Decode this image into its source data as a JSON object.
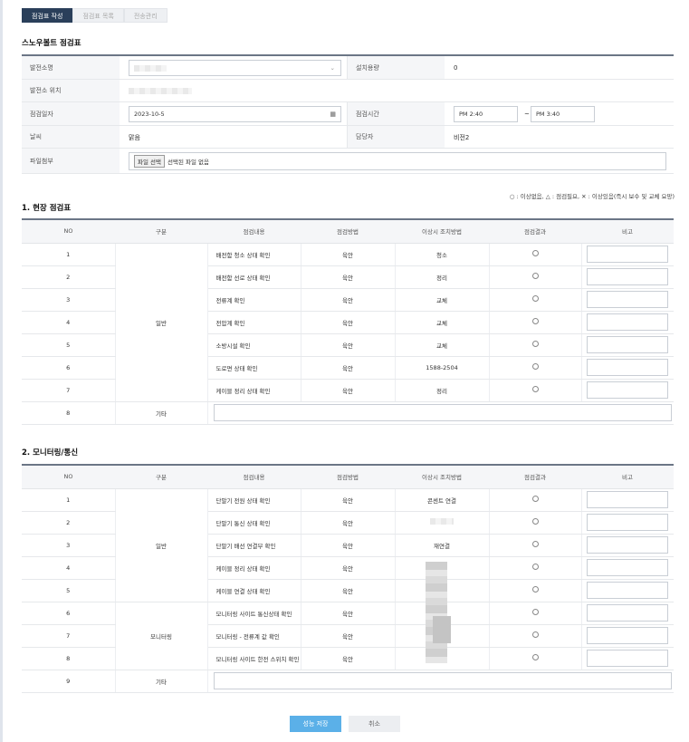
{
  "tabs": [
    {
      "label": "점검표 작성",
      "active": true
    },
    {
      "label": "점검표 목록",
      "active": false
    },
    {
      "label": "전송관리",
      "active": false
    }
  ],
  "form": {
    "title": "스노우볼트 점검표",
    "plant_name_label": "발전소명",
    "capacity_label": "설치용량",
    "capacity_value": "0",
    "location_label": "발전소 위치",
    "date_label": "점검일자",
    "date_value": "2023-10-5",
    "time_label": "점검시간",
    "time_start": "PM 2:40",
    "time_sep": "~",
    "time_end": "PM 3:40",
    "weather_label": "날씨",
    "weather_value": "맑음",
    "manager_label": "담당자",
    "manager_value": "비전2",
    "file_label": "파일첨부",
    "file_button": "파일 선택",
    "file_status": "선택된 파일 없음"
  },
  "legend": "○ : 이상없음, △ : 점검필요, ✕ : 이상있음(즉시 보수 및 교체 요망)",
  "section1": {
    "title": "1. 현장 점검표",
    "headers": [
      "NO",
      "구분",
      "점검내용",
      "점검방법",
      "이상시 조치방법",
      "점검결과",
      "비고"
    ],
    "group": "일반",
    "rows": [
      {
        "no": "1",
        "content": "배전함 청소 상태 확인",
        "method": "육안",
        "action": "청소"
      },
      {
        "no": "2",
        "content": "배전함 선로 상태 확인",
        "method": "육안",
        "action": "정리"
      },
      {
        "no": "3",
        "content": "전류계 확인",
        "method": "육안",
        "action": "교체"
      },
      {
        "no": "4",
        "content": "전압계 확인",
        "method": "육안",
        "action": "교체"
      },
      {
        "no": "5",
        "content": "소방시설 확인",
        "method": "육안",
        "action": "교체"
      },
      {
        "no": "6",
        "content": "도로면 상태 확인",
        "method": "육안",
        "action": "1588-2504"
      },
      {
        "no": "7",
        "content": "케이블 정리 상태 확인",
        "method": "육안",
        "action": "정리"
      }
    ],
    "etc": {
      "no": "8",
      "label": "기타"
    }
  },
  "section2": {
    "title": "2. 모니터링/통신",
    "headers": [
      "NO",
      "구분",
      "점검내용",
      "점검방법",
      "이상시 조치방법",
      "점검결과",
      "비고"
    ],
    "group1": "일반",
    "group2": "모니터링",
    "rows": [
      {
        "no": "1",
        "content": "단말기 전원 상태 확인",
        "method": "육안",
        "action": "콘센트 연결"
      },
      {
        "no": "2",
        "content": "단말기 통신 상태 확인",
        "method": "육안",
        "action": ""
      },
      {
        "no": "3",
        "content": "단말기 배선 연결부 확인",
        "method": "육안",
        "action": "재연결"
      },
      {
        "no": "4",
        "content": "케이블 정리 상태 확인",
        "method": "육안",
        "action": ""
      },
      {
        "no": "5",
        "content": "케이블 연결 상태 확인",
        "method": "육안",
        "action": ""
      },
      {
        "no": "6",
        "content": "모니터링 사이트 통신상태 확인",
        "method": "육안",
        "action": ""
      },
      {
        "no": "7",
        "content": "모니터링 - 전류계 값 확인",
        "method": "육안",
        "action": ""
      },
      {
        "no": "8",
        "content": "모니터링 사이트 한전 스위치 확인",
        "method": "육안",
        "action": ""
      }
    ],
    "etc": {
      "no": "9",
      "label": "기타"
    }
  },
  "buttons": {
    "save": "성능 저장",
    "cancel": "취소"
  }
}
